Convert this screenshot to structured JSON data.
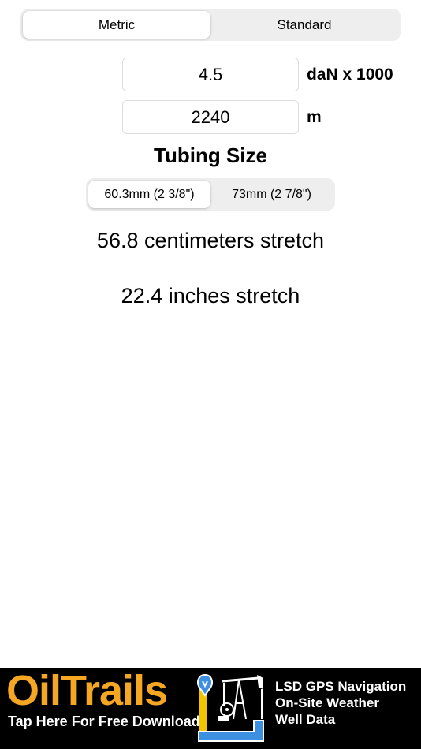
{
  "unit_selector": {
    "options": [
      "Metric",
      "Standard"
    ],
    "selected": "Metric"
  },
  "load": {
    "value": "4.5",
    "unit": "daN x 1000"
  },
  "depth": {
    "value": "2240",
    "unit": "m"
  },
  "tubing": {
    "title": "Tubing Size",
    "options": [
      "60.3mm (2 3/8\")",
      "73mm (2 7/8\")"
    ],
    "selected": "60.3mm (2 3/8\")"
  },
  "results": {
    "metric": "56.8 centimeters stretch",
    "imperial": "22.4 inches stretch"
  },
  "ad": {
    "brand": "OilTrails",
    "tagline": "Tap Here For Free Download",
    "features": [
      "LSD GPS Navigation",
      "On-Site Weather",
      "Well Data"
    ],
    "colors": {
      "brand": "#f5a623",
      "background": "#000000",
      "pin": "#3d8fe0"
    }
  }
}
